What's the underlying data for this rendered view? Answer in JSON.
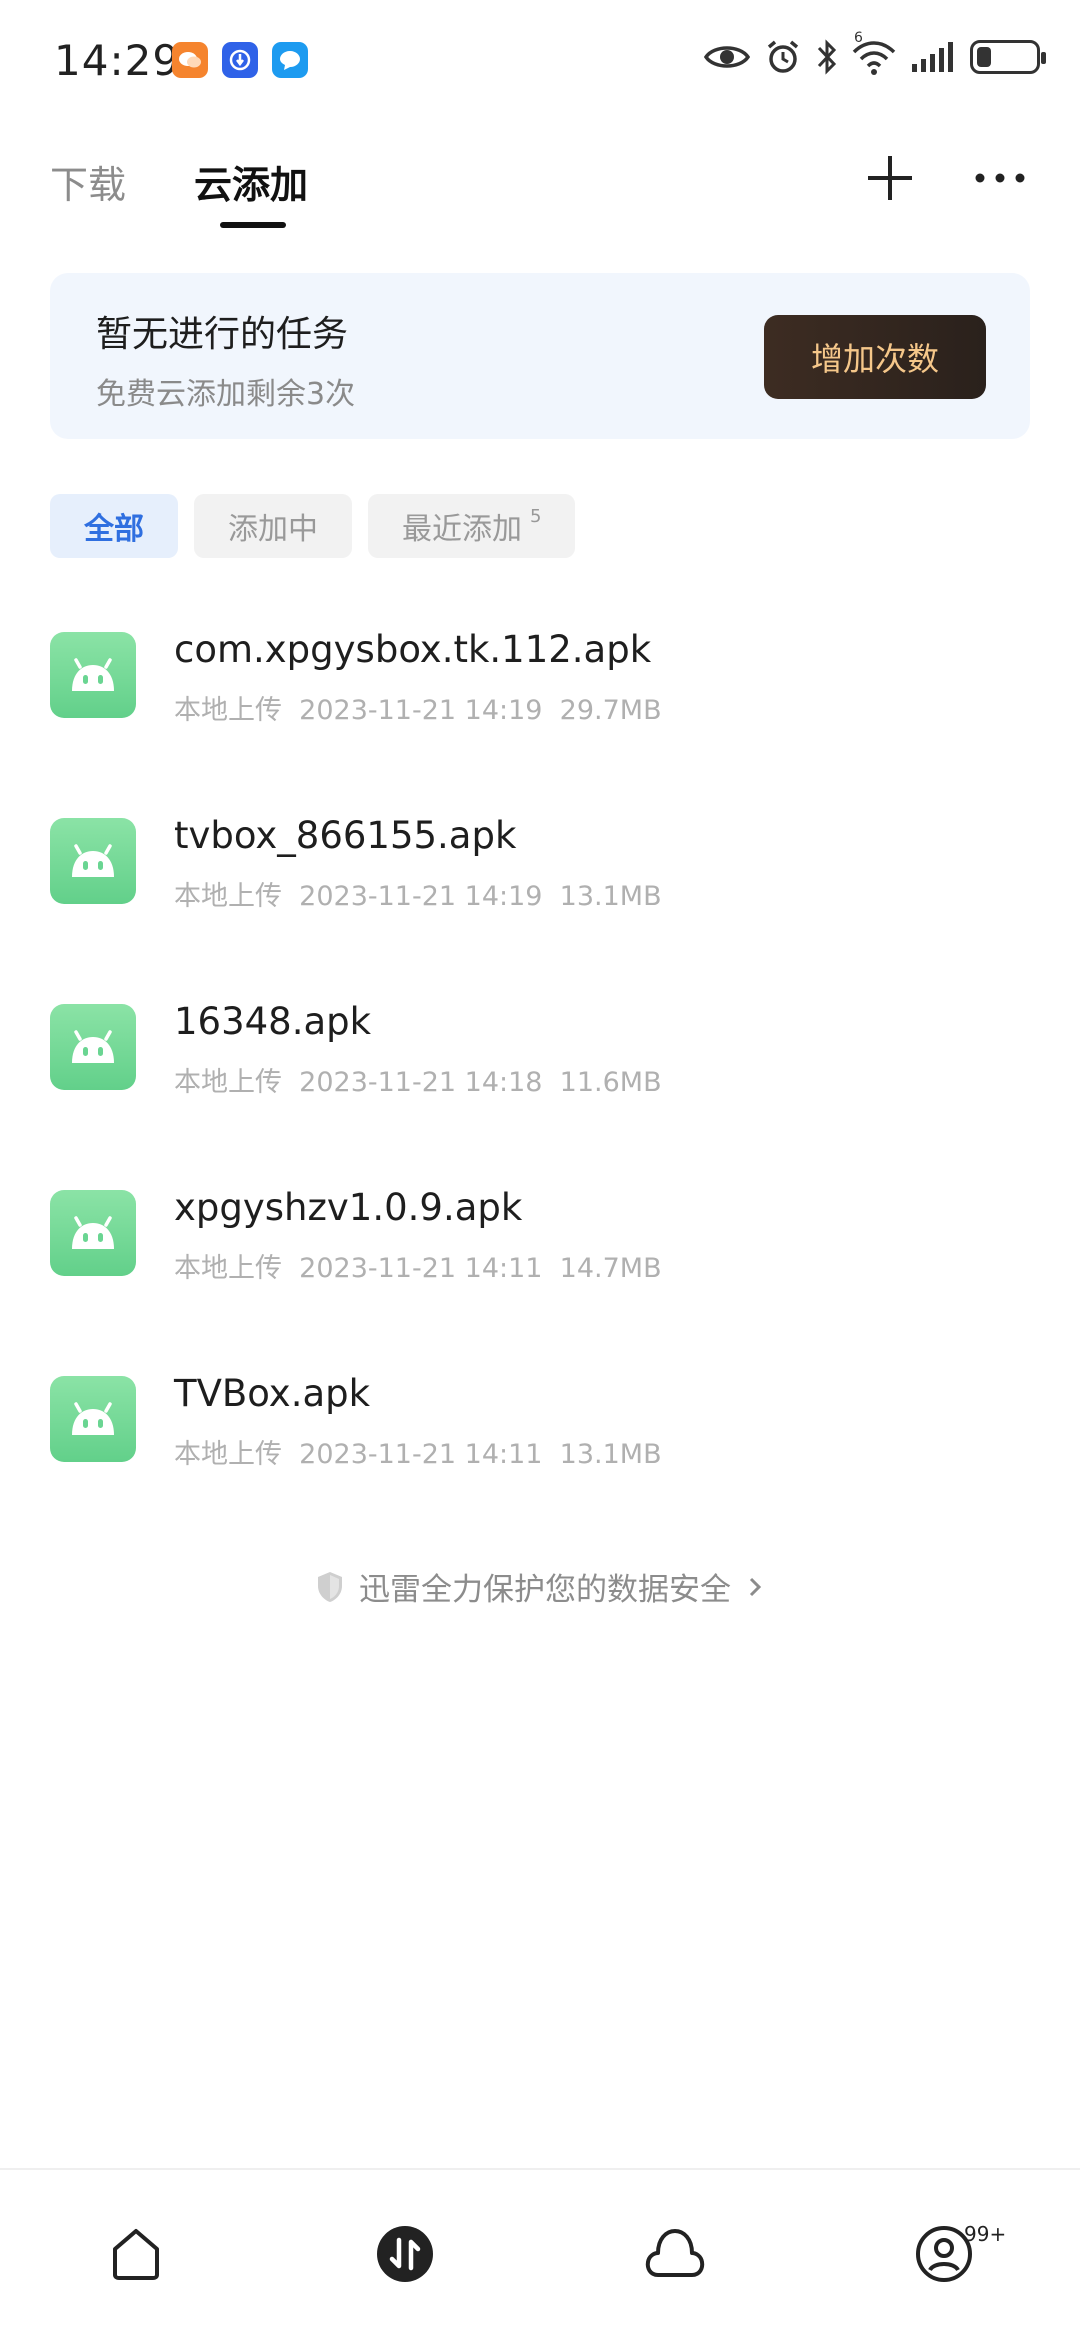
{
  "status_bar": {
    "time": "14:29",
    "notification_icons": [
      "chat-app-icon",
      "browser-app-icon",
      "message-app-icon"
    ],
    "system_icons": [
      "eye-icon",
      "alarm-icon",
      "bluetooth-icon",
      "wifi-icon",
      "signal-icon",
      "battery-icon"
    ],
    "wifi_label": "6"
  },
  "tabs": {
    "download": "下载",
    "cloud_add": "云添加"
  },
  "task_card": {
    "title": "暂无进行的任务",
    "subtitle": "免费云添加剩余3次",
    "button": "增加次数"
  },
  "filters": {
    "all": "全部",
    "adding": "添加中",
    "recent": "最近添加",
    "recent_count": "5"
  },
  "files": [
    {
      "name": "com.xpgysbox.tk.112.apk",
      "source": "本地上传",
      "datetime": "2023-11-21 14:19",
      "size": "29.7MB"
    },
    {
      "name": "tvbox_866155.apk",
      "source": "本地上传",
      "datetime": "2023-11-21 14:19",
      "size": "13.1MB"
    },
    {
      "name": "16348.apk",
      "source": "本地上传",
      "datetime": "2023-11-21 14:18",
      "size": "11.6MB"
    },
    {
      "name": "xpgyshzv1.0.9.apk",
      "source": "本地上传",
      "datetime": "2023-11-21 14:11",
      "size": "14.7MB"
    },
    {
      "name": "TVBox.apk",
      "source": "本地上传",
      "datetime": "2023-11-21 14:11",
      "size": "13.1MB"
    }
  ],
  "security_note": "迅雷全力保护您的数据安全",
  "bottom_nav": {
    "items": [
      "home-icon",
      "transfer-icon",
      "cloud-icon",
      "profile-icon"
    ],
    "profile_badge": "99+"
  },
  "colors": {
    "accent_blue": "#2f6fe0",
    "apk_green": "#6ad592",
    "gold_button_text": "#f5c78a",
    "card_bg": "#f1f6fd"
  }
}
